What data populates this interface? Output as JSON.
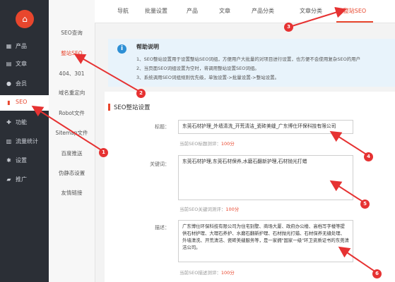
{
  "logo_glyph": "⌂",
  "sidebar": {
    "items": [
      {
        "label": "产品",
        "icon": "grid-icon"
      },
      {
        "label": "文章",
        "icon": "document-icon"
      },
      {
        "label": "会员",
        "icon": "user-icon"
      },
      {
        "label": "SEO",
        "icon": "seo-icon"
      },
      {
        "label": "功能",
        "icon": "wrench-icon"
      },
      {
        "label": "流量统计",
        "icon": "bar-chart-icon"
      },
      {
        "label": "设置",
        "icon": "gear-icon"
      },
      {
        "label": "推广",
        "icon": "broadcast-icon"
      }
    ]
  },
  "submenu": {
    "items": [
      "SEO查询",
      "整站SEO",
      "404、301",
      "域名重定向",
      "Robot文件",
      "Sitemap文件",
      "百度推送",
      "伪静态设置",
      "友情链接"
    ]
  },
  "tabs": [
    "导航",
    "批量设置",
    "产品",
    "文章",
    "产品分类",
    "文章分类",
    "整站SEO"
  ],
  "help": {
    "title": "帮助说明",
    "lines": [
      "1、SEO整站设置用于设置整站SEO词组，方便用户大批量的对项目进行设置，也方便不会使用复杂SEO的用户",
      "2、当页面SEO词组设置为空时，将调用整站设置SEO词组。",
      "3、系统调用SEO词组规则优先级，单独设置->批量设置->整站设置。"
    ]
  },
  "section": {
    "title": "SEO整站设置"
  },
  "form": {
    "title": {
      "label": "标题：",
      "value": "东莞石材护理_外墙清洗_开荒清洁_瓷砖美缝_广东博仕环保科技有限公司",
      "hint_prefix": "当前SEO标题测评：",
      "hint_score": "100分"
    },
    "keywords": {
      "label": "关键词：",
      "value": "东莞石材护理,东莞石材保养,水磨石翻新护理,石材抛光打蜡",
      "hint_prefix": "当前SEO关键词测评：",
      "hint_score": "100分"
    },
    "description": {
      "label": "描述：",
      "value": "广东博仕环保科技有限公司为住宅别墅、商场大厦、政府办公楼、高档写字楼等提供石材护理、大理石养护、水磨石翻新护理、石材抛光打蜡、石材保养无缝处理、外墙清洗、开荒清洁、瓷砖美缝服务等，是一家拥\"国家一级\"环卫资质证书的东莞清洁公司。",
      "hint_prefix": "当前SEO描述测评：",
      "hint_score": "100分"
    }
  },
  "annotations": [
    "1",
    "2",
    "3",
    "4",
    "5",
    "6"
  ],
  "colors": {
    "accent": "#e8462d",
    "sidebar_bg": "#2b2f36",
    "help_bg": "#e8f3fb",
    "arrow": "#e63232"
  }
}
